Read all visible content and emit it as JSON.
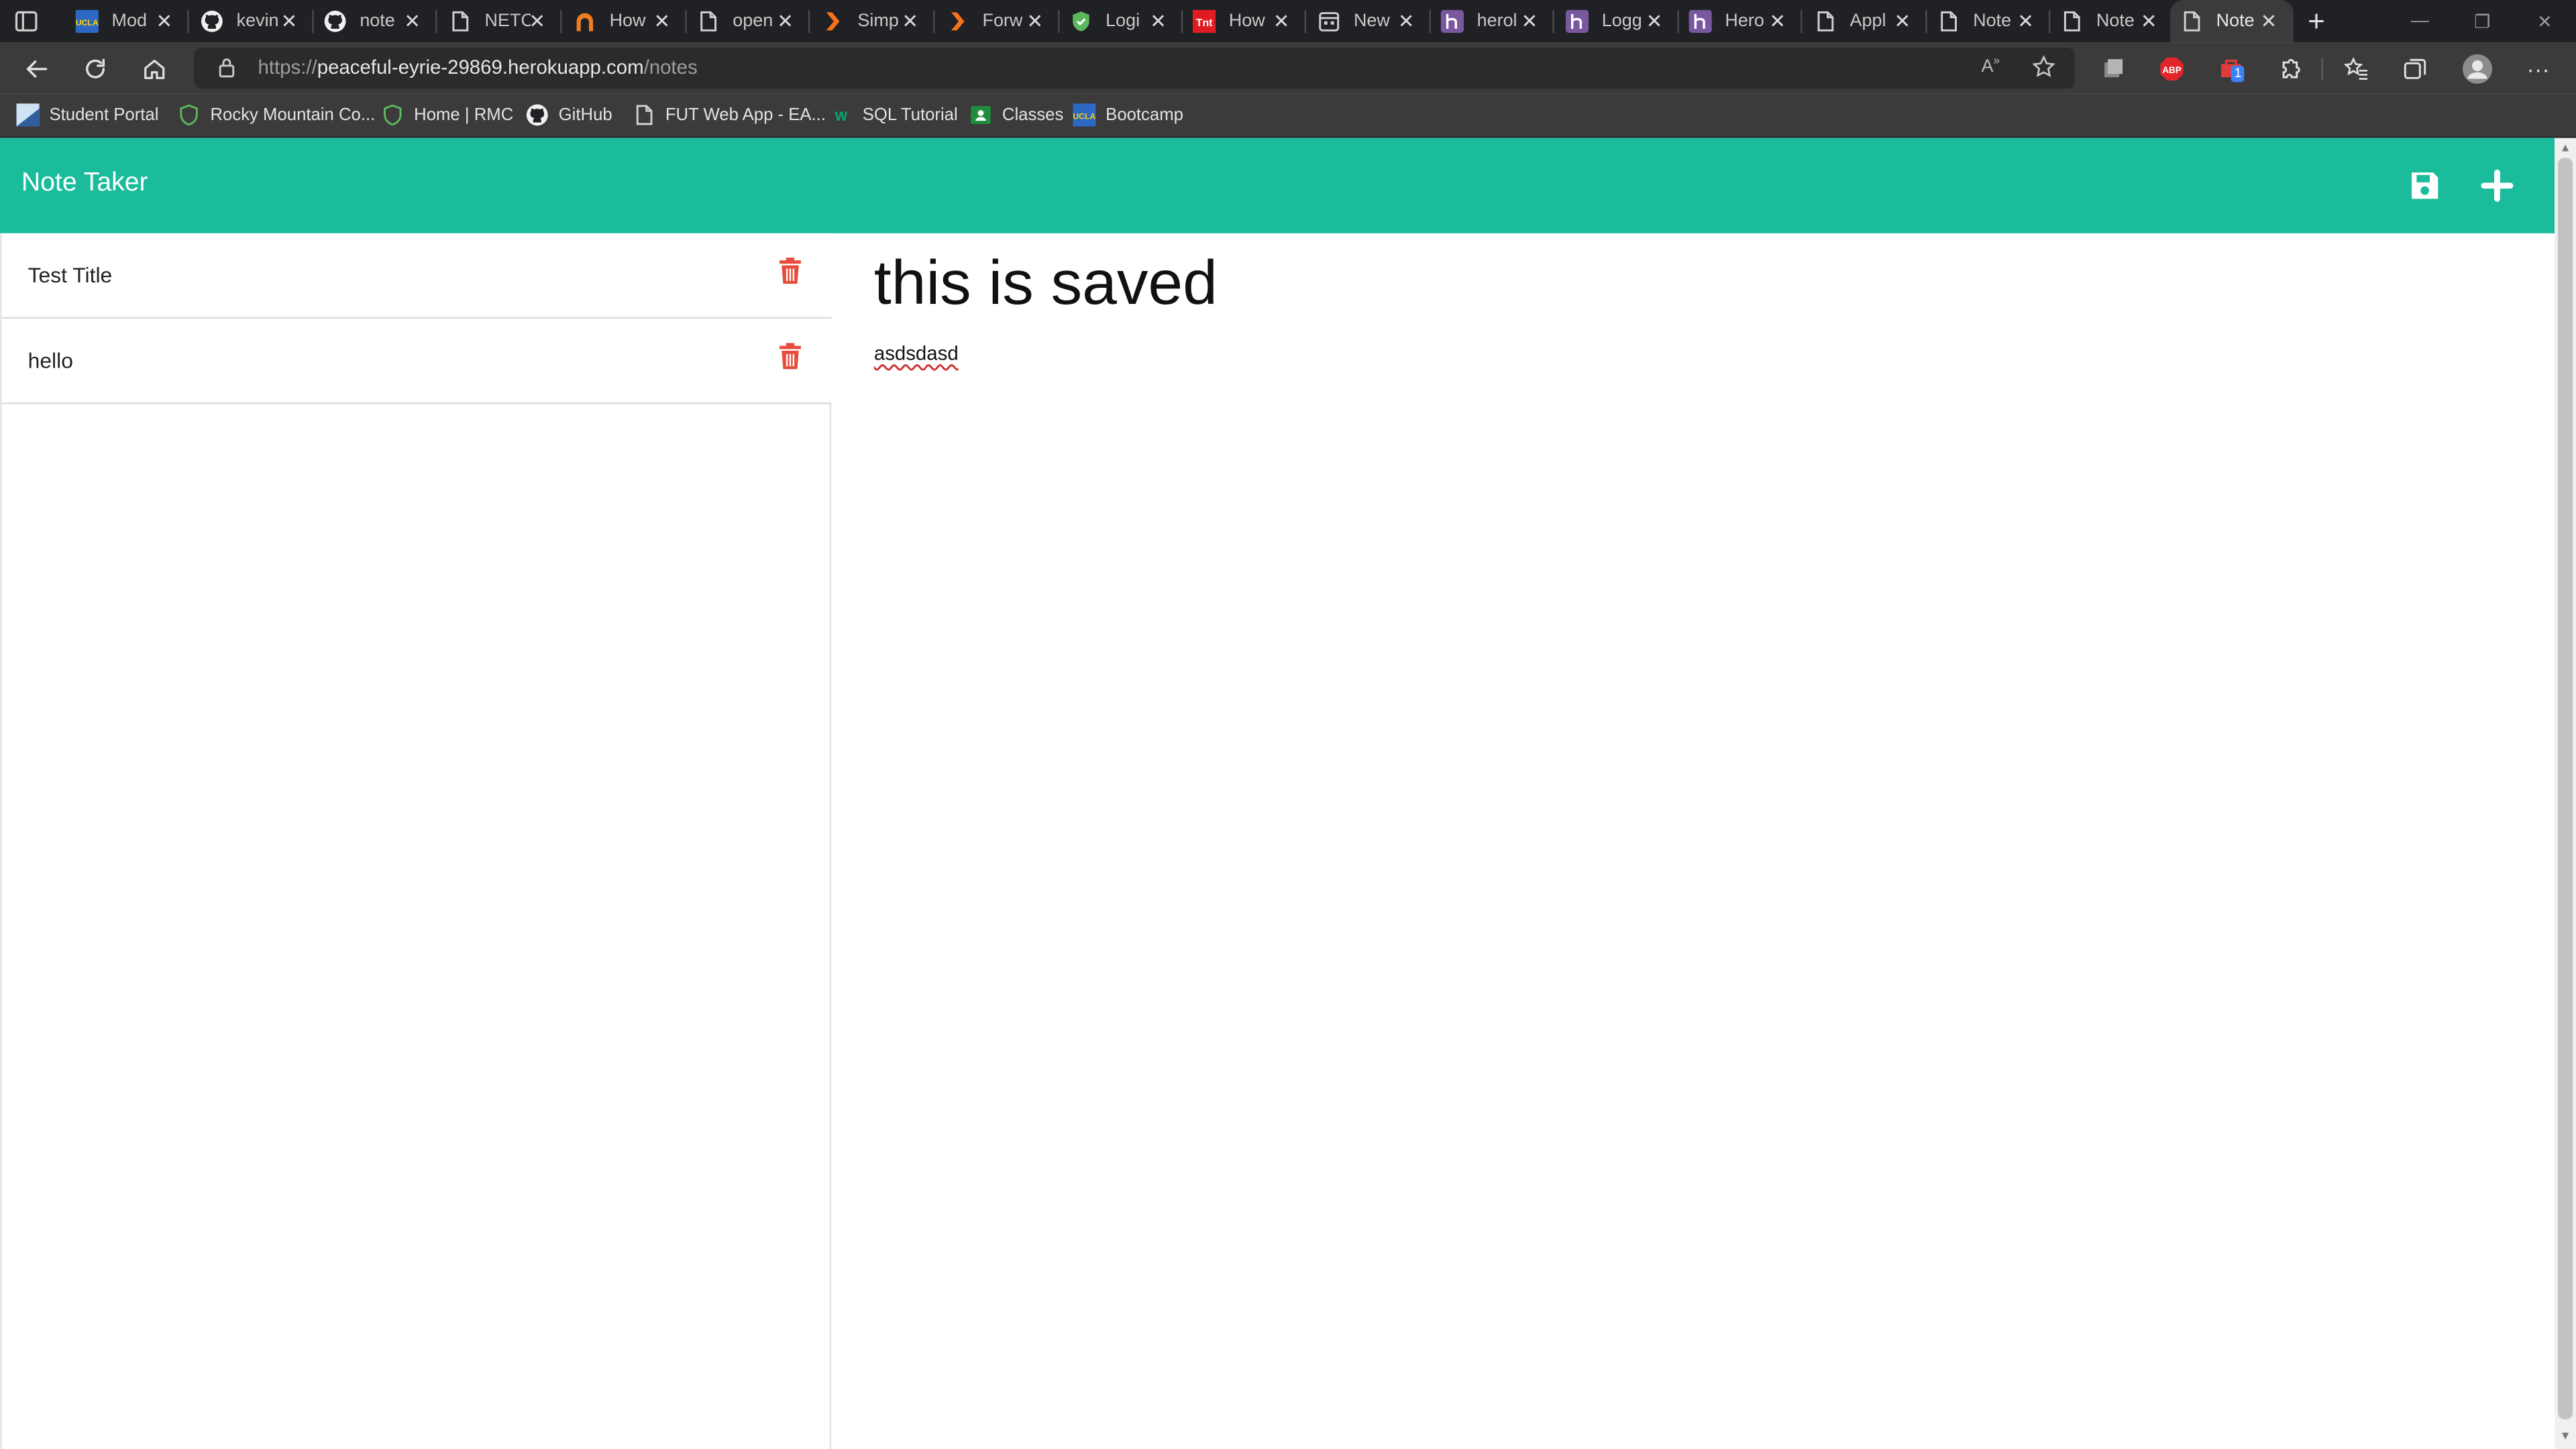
{
  "browser": {
    "tabs": [
      {
        "title": "Mod",
        "icon": "ucla-icon"
      },
      {
        "title": "kevin",
        "icon": "github-icon"
      },
      {
        "title": "note",
        "icon": "github-icon"
      },
      {
        "title": "NETC",
        "icon": "page-icon"
      },
      {
        "title": "How",
        "icon": "orange-arch-icon"
      },
      {
        "title": "open",
        "icon": "page-icon"
      },
      {
        "title": "Simp",
        "icon": "chevron-orange-icon"
      },
      {
        "title": "Forw",
        "icon": "chevron-orange-icon"
      },
      {
        "title": "Logi",
        "icon": "shield-green-icon"
      },
      {
        "title": "How",
        "icon": "tnt-icon"
      },
      {
        "title": "New",
        "icon": "calendar-icon"
      },
      {
        "title": "herol",
        "icon": "heroku-icon"
      },
      {
        "title": "Logg",
        "icon": "heroku-icon"
      },
      {
        "title": "Hero",
        "icon": "heroku-icon"
      },
      {
        "title": "Appl",
        "icon": "page-icon"
      },
      {
        "title": "Note",
        "icon": "page-icon"
      },
      {
        "title": "Note",
        "icon": "page-icon"
      },
      {
        "title": "Note",
        "icon": "page-icon"
      }
    ],
    "active_tab_index": 17,
    "url_scheme": "https://",
    "url_host": "peaceful-eyrie-29869.herokuapp.com",
    "url_path": "/notes",
    "bookmarks": [
      {
        "label": "Student Portal",
        "icon": "portal-icon"
      },
      {
        "label": "Rocky Mountain Co...",
        "icon": "shield-outline-icon"
      },
      {
        "label": "Home | RMC",
        "icon": "shield-outline-icon"
      },
      {
        "label": "GitHub",
        "icon": "github-icon"
      },
      {
        "label": "FUT Web App - EA...",
        "icon": "page-icon"
      },
      {
        "label": "SQL Tutorial",
        "icon": "w3-icon"
      },
      {
        "label": "Classes",
        "icon": "classroom-icon"
      },
      {
        "label": "Bootcamp",
        "icon": "ucla-icon"
      }
    ],
    "extension_badge": "1"
  },
  "app": {
    "brand": "Note Taker",
    "accent_color": "#1abc9c",
    "delete_color": "#e74c3c",
    "notes": [
      {
        "title": "Test Title"
      },
      {
        "title": "hello"
      }
    ],
    "active_note": {
      "title": "this is saved",
      "text": "asdsdasd"
    }
  }
}
